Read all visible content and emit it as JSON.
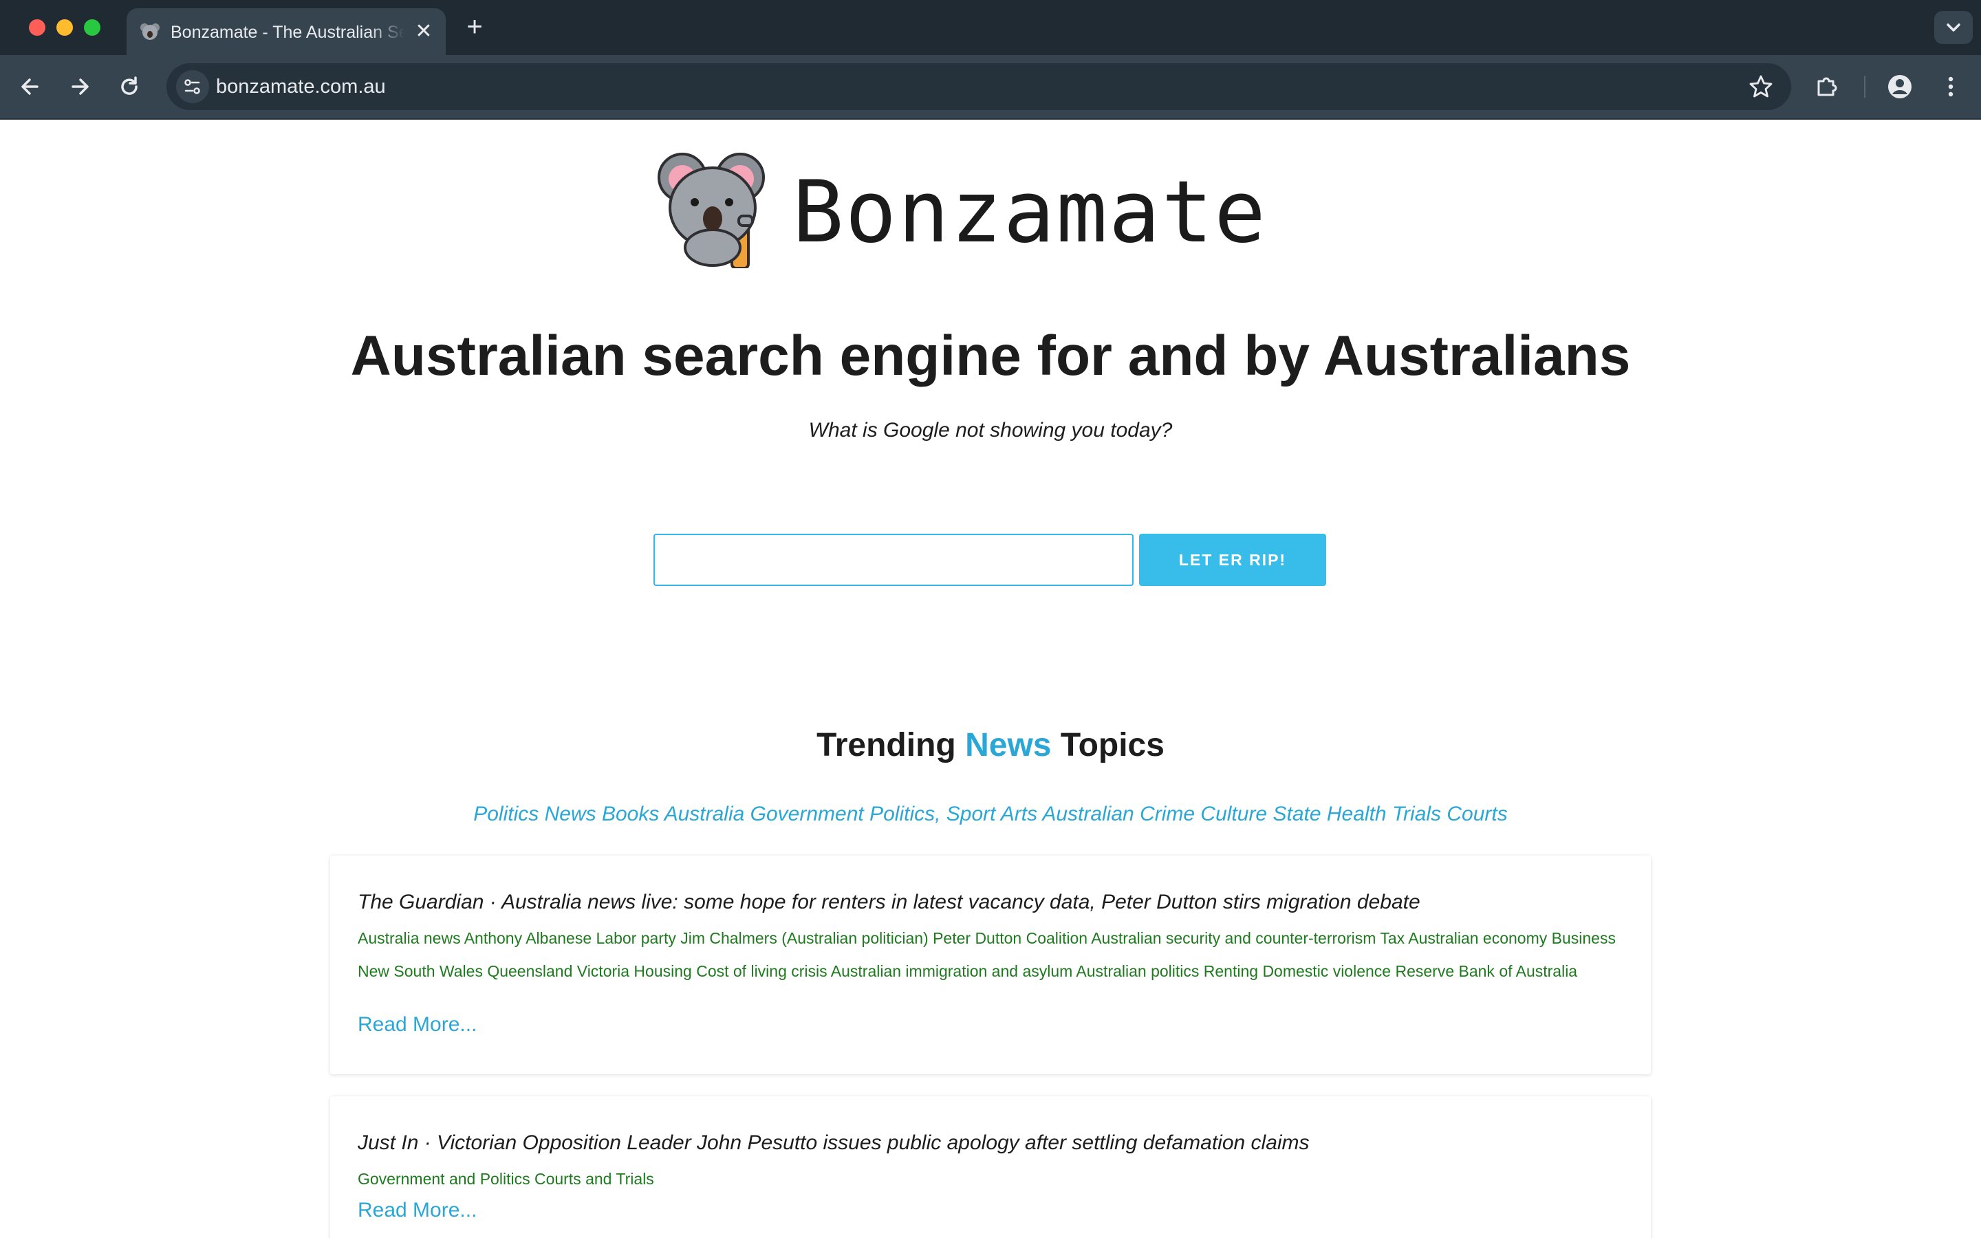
{
  "browser": {
    "tab_title": "Bonzamate - The Australian Search Engine",
    "tab_close": "✕",
    "new_tab": "+",
    "url": "bonzamate.com.au"
  },
  "icons": {
    "back": "back-arrow-icon",
    "forward": "forward-arrow-icon",
    "reload": "reload-icon",
    "site_info": "tune-icon",
    "bookmark": "star-icon",
    "extensions": "puzzle-icon",
    "profile": "profile-icon",
    "menu": "kebab-menu-icon",
    "logo": "koala-icon"
  },
  "colors": {
    "accent": "#2aa7d6",
    "button": "#38bdea",
    "tag_green": "#1f7a1f"
  },
  "logo": {
    "text": "Bonzamate"
  },
  "hero": {
    "headline": "Australian search engine for and by Australians",
    "subline": "What is Google not showing you today?"
  },
  "search": {
    "value": "",
    "placeholder": "",
    "button_label": "LET ER RIP!"
  },
  "trending": {
    "title_prefix": "Trending",
    "title_accent": "News",
    "title_suffix": "Topics",
    "topics": [
      "Politics",
      "News",
      "Books",
      "Australia",
      "Government",
      "Politics,",
      "Sport",
      "Arts",
      "Australian",
      "Crime",
      "Culture",
      "State",
      "Health",
      "Trials",
      "Courts"
    ]
  },
  "articles": [
    {
      "title": "The Guardian · Australia news live: some hope for renters in latest vacancy data, Peter Dutton stirs migration debate",
      "tags": "Australia news Anthony Albanese Labor party Jim Chalmers (Australian politician) Peter Dutton Coalition Australian security and counter-terrorism Tax Australian economy Business New South Wales Queensland Victoria Housing Cost of living crisis Australian immigration and asylum Australian politics Renting Domestic violence Reserve Bank of Australia",
      "read_more": "Read More..."
    },
    {
      "title": "Just In · Victorian Opposition Leader John Pesutto issues public apology after settling defamation claims",
      "tags": "Government and Politics Courts and Trials",
      "read_more": "Read More..."
    }
  ]
}
